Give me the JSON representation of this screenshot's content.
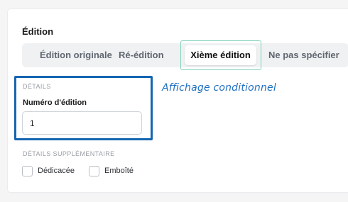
{
  "section": {
    "title": "Édition"
  },
  "edition_tabs": {
    "options": [
      "Édition originale",
      "Ré-édition",
      "Xième édition",
      "Ne pas spécifier"
    ],
    "selected": "Xième édition",
    "selected_index": 2
  },
  "details": {
    "group_label": "DÉTAILS",
    "field_label": "Numéro d'édition",
    "field_value": "1"
  },
  "annotation": {
    "text": "Affichage conditionnel"
  },
  "extra_details": {
    "group_label": "DÉTAILS SUPPLÉMENTAIRE",
    "checkboxes": [
      {
        "label": "Dédicacée",
        "checked": false
      },
      {
        "label": "Emboîté",
        "checked": false
      }
    ]
  },
  "colors": {
    "accent_outline": "#7fd1b8",
    "highlight_box": "#1565b0",
    "annotation_text": "#1f6fc2"
  }
}
